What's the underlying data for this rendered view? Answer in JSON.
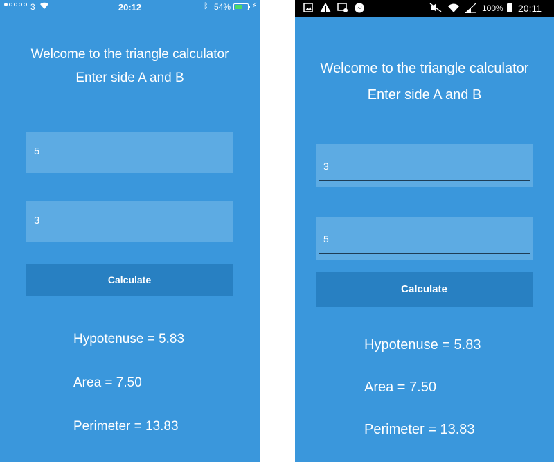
{
  "ios": {
    "status": {
      "carrier": "3",
      "time": "20:12",
      "battery_percent": "54%",
      "battery_level": 0.54,
      "icons": [
        "signal-dots-icon",
        "wifi-icon",
        "bluetooth-icon",
        "battery-icon",
        "charging-bolt-icon"
      ]
    },
    "title": "Welcome to the triangle calculator",
    "subtitle": "Enter side A and B",
    "side_a_value": "5",
    "side_b_value": "3",
    "calculate_label": "Calculate",
    "hypotenuse": "Hypotenuse = 5.83",
    "area": "Area = 7.50",
    "perimeter": "Perimeter = 13.83"
  },
  "android": {
    "status": {
      "time": "20:11",
      "battery_percent": "100%",
      "icons": [
        "image-icon",
        "warning-icon",
        "voicemail-icon",
        "messenger-icon",
        "mute-icon",
        "wifi-icon",
        "signal-icon",
        "battery-icon"
      ]
    },
    "title": "Welcome to the triangle calculator",
    "subtitle": "Enter side A and B",
    "side_a_value": "3",
    "side_b_value": "5",
    "calculate_label": "Calculate",
    "hypotenuse": "Hypotenuse = 5.83",
    "area": "Area = 7.50",
    "perimeter": "Perimeter = 13.83"
  },
  "colors": {
    "background": "#3a97dc",
    "field": "#5dabe3",
    "button": "#2880c2",
    "text": "#ffffff"
  }
}
